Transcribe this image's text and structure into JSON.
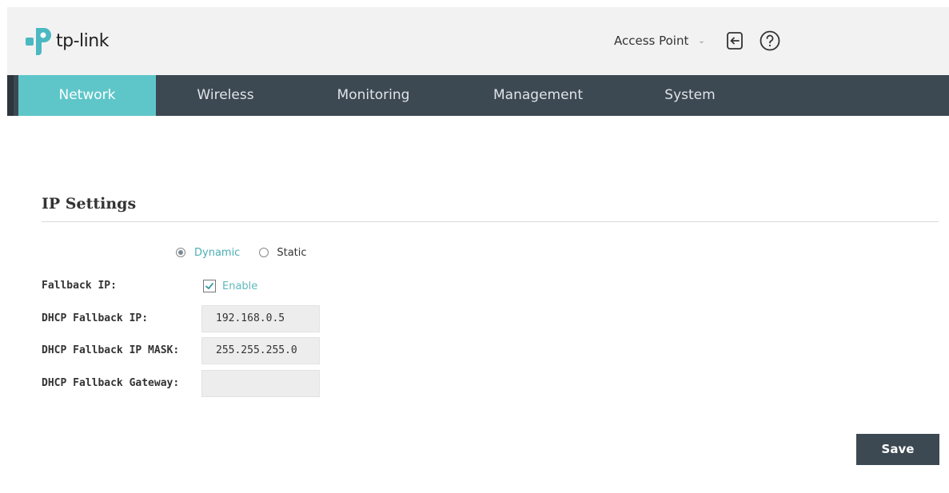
{
  "header": {
    "logo_text": "tp-link",
    "mode_label": "Access Point",
    "mode_caret": "⌄",
    "logout_icon": "logout-icon",
    "help_icon": "help-icon"
  },
  "nav": {
    "tabs": [
      {
        "label": "Network",
        "active": true
      },
      {
        "label": "Wireless",
        "active": false
      },
      {
        "label": "Monitoring",
        "active": false
      },
      {
        "label": "Management",
        "active": false
      },
      {
        "label": "System",
        "active": false
      }
    ]
  },
  "ip_settings": {
    "title": "IP Settings",
    "mode_options": [
      {
        "label": "Dynamic",
        "selected": true
      },
      {
        "label": "Static",
        "selected": false
      }
    ],
    "fallback_ip": {
      "label": "Fallback IP:",
      "checkbox_label": "Enable",
      "checked": true
    },
    "dhcp_fallback_ip": {
      "label": "DHCP Fallback IP:",
      "value": "192.168.0.5"
    },
    "dhcp_fallback_mask": {
      "label": "DHCP Fallback IP MASK:",
      "value": "255.255.255.0"
    },
    "dhcp_fallback_gateway": {
      "label": "DHCP Fallback Gateway:",
      "value": ""
    }
  },
  "actions": {
    "save_label": "Save"
  },
  "colors": {
    "accent": "#5ec6c9",
    "nav_bg": "#3c4852",
    "header_bg": "#f2f2f2"
  }
}
